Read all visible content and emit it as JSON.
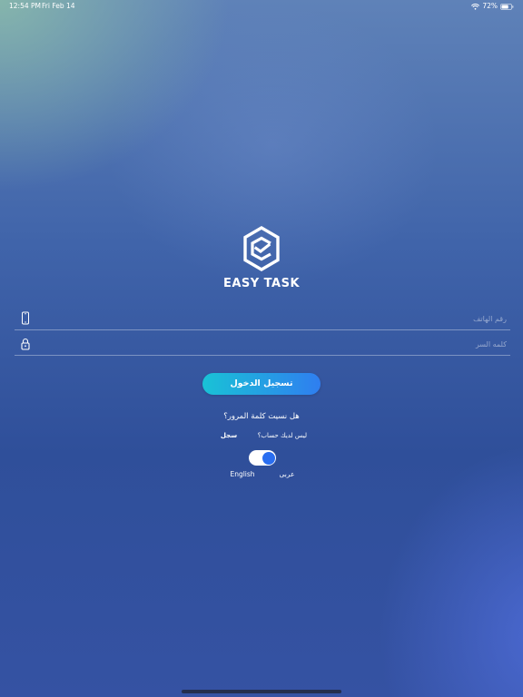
{
  "status_bar": {
    "time": "12:54 PM",
    "date": "Fri Feb 14",
    "battery_percent": "72%",
    "battery_level": 0.72,
    "wifi_icon": "wifi-icon",
    "battery_icon": "battery-icon"
  },
  "brand": {
    "name": "EASY TASK",
    "logo_icon": "easy-task-logo"
  },
  "form": {
    "phone": {
      "placeholder": "رقم الهاتف",
      "value": "",
      "icon": "phone-icon"
    },
    "password": {
      "placeholder": "كلمه السر",
      "value": "",
      "icon": "lock-icon"
    },
    "login_label": "تسجيل الدخول",
    "forgot_label": "هل نسيت كلمة المرور؟",
    "no_account_label": "ليس لديك حساب؟",
    "register_label": "سجل"
  },
  "language": {
    "english_label": "English",
    "arabic_label": "عربى",
    "toggle_on": true
  },
  "colors": {
    "button_start": "#19c2d6",
    "button_end": "#2f7ef0",
    "toggle_knob": "#2a6ef0"
  }
}
